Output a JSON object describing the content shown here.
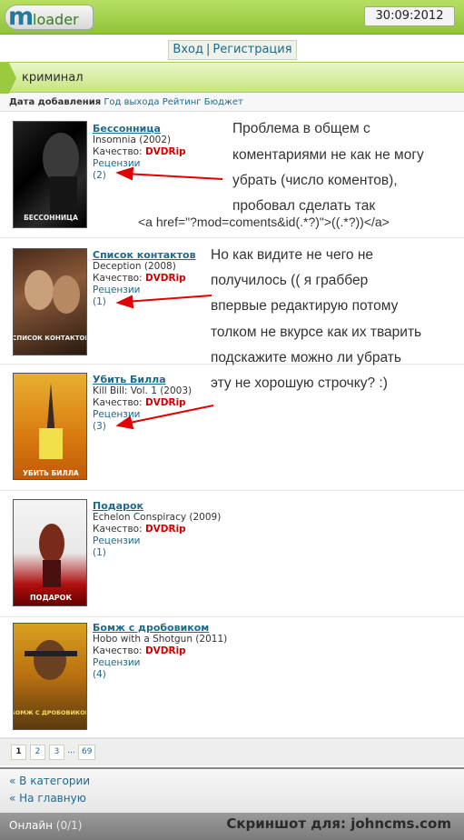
{
  "header": {
    "logo_m": "m",
    "logo_text": "loader",
    "clock": "30:09:2012"
  },
  "auth": {
    "login": "Вход",
    "separator": "|",
    "register": "Регистрация"
  },
  "category": {
    "title": "криминал"
  },
  "sort": {
    "label": "Дата добавления",
    "links": [
      "Год выхода",
      "Рейтинг",
      "Бюджет"
    ]
  },
  "labels": {
    "quality": "Качество:",
    "reviews": "Рецензии"
  },
  "items": [
    {
      "title": "Бессонница",
      "original": "Insomnia (2002)",
      "quality": "DVDRip",
      "count": "(2)",
      "poster_text": "БЕССОННИЦА"
    },
    {
      "title": "Список контактов",
      "original": "Deception (2008)",
      "quality": "DVDRip",
      "count": "(1)",
      "poster_text": "СПИСОК КОНТАКТОВ"
    },
    {
      "title": "Убить Билла",
      "original": "Kill Bill: Vol. 1 (2003)",
      "quality": "DVDRip",
      "count": "(3)",
      "poster_text": "УБИТЬ БИЛЛА"
    },
    {
      "title": "Подарок",
      "original": "Echelon Conspiracy (2009)",
      "quality": "DVDRip",
      "count": "(1)",
      "poster_text": "ПОДАРОК"
    },
    {
      "title": "Бомж с дробовиком",
      "original": "Hobo with a Shotgun (2011)",
      "quality": "DVDRip",
      "count": "(4)",
      "poster_text": "БОМЖ С ДРОБОВИКОМ"
    }
  ],
  "notes": {
    "line1": "Проблема в общем с",
    "line2": "коментариями не как не могу",
    "line3": "убрать (число коментов),",
    "line4": "пробовал сделать так",
    "line5": "<a href=\"?mod=coments&id(.*?)\">((.*?))</a>",
    "line6": "Но как видите не чего не",
    "line7": "получилось (( я граббер",
    "line8": "впервые редактирую потому",
    "line9": "толком не вкурсе как их тварить",
    "line10": "подскажите можно ли убрать",
    "line11": "эту не хорошую строчку? :)"
  },
  "pager": {
    "pages": [
      "1",
      "2",
      "3",
      "...",
      "69"
    ]
  },
  "footer": {
    "to_categories": "« В категории",
    "to_home": "« На главную"
  },
  "bottom": {
    "online_label": "Онлайн",
    "online_count": "(0/1)",
    "credit": "Скриншот для: johncms.com"
  },
  "colors": {
    "accent_green": "#9acb3e",
    "link": "#1e6a8c",
    "quality": "#d40000",
    "annotation_arrow": "#e00000"
  }
}
